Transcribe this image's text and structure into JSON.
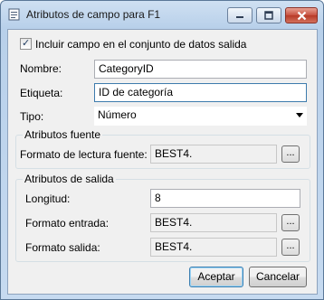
{
  "window": {
    "title": "Atributos de campo para F1"
  },
  "include_checkbox": {
    "label": "Incluir campo en el conjunto de datos salida",
    "checked": true
  },
  "fields": {
    "nombre_label": "Nombre:",
    "nombre_value": "CategoryID",
    "etiqueta_label": "Etiqueta:",
    "etiqueta_value": "ID de categoría",
    "tipo_label": "Tipo:",
    "tipo_value": "Número"
  },
  "atributos_fuente": {
    "title": "Atributos fuente",
    "formato_lectura_label": "Formato de lectura fuente:",
    "formato_lectura_value": "BEST4.",
    "browse_label": "..."
  },
  "atributos_salida": {
    "title": "Atributos de salida",
    "longitud_label": "Longitud:",
    "longitud_value": "8",
    "formato_entrada_label": "Formato entrada:",
    "formato_entrada_value": "BEST4.",
    "formato_salida_label": "Formato salida:",
    "formato_salida_value": "BEST4.",
    "browse_label": "..."
  },
  "buttons": {
    "accept": "Aceptar",
    "cancel": "Cancelar"
  },
  "icons": {
    "window": "dialog-icon",
    "minimize": "minimize-icon",
    "maximize": "maximize-icon",
    "close": "close-icon",
    "dropdown": "chevron-down-icon"
  },
  "colors": {
    "titlebar": "#c6daf0",
    "client": "#f0f0f0",
    "close_button": "#c7503f",
    "focus_border": "#3d7bad"
  }
}
